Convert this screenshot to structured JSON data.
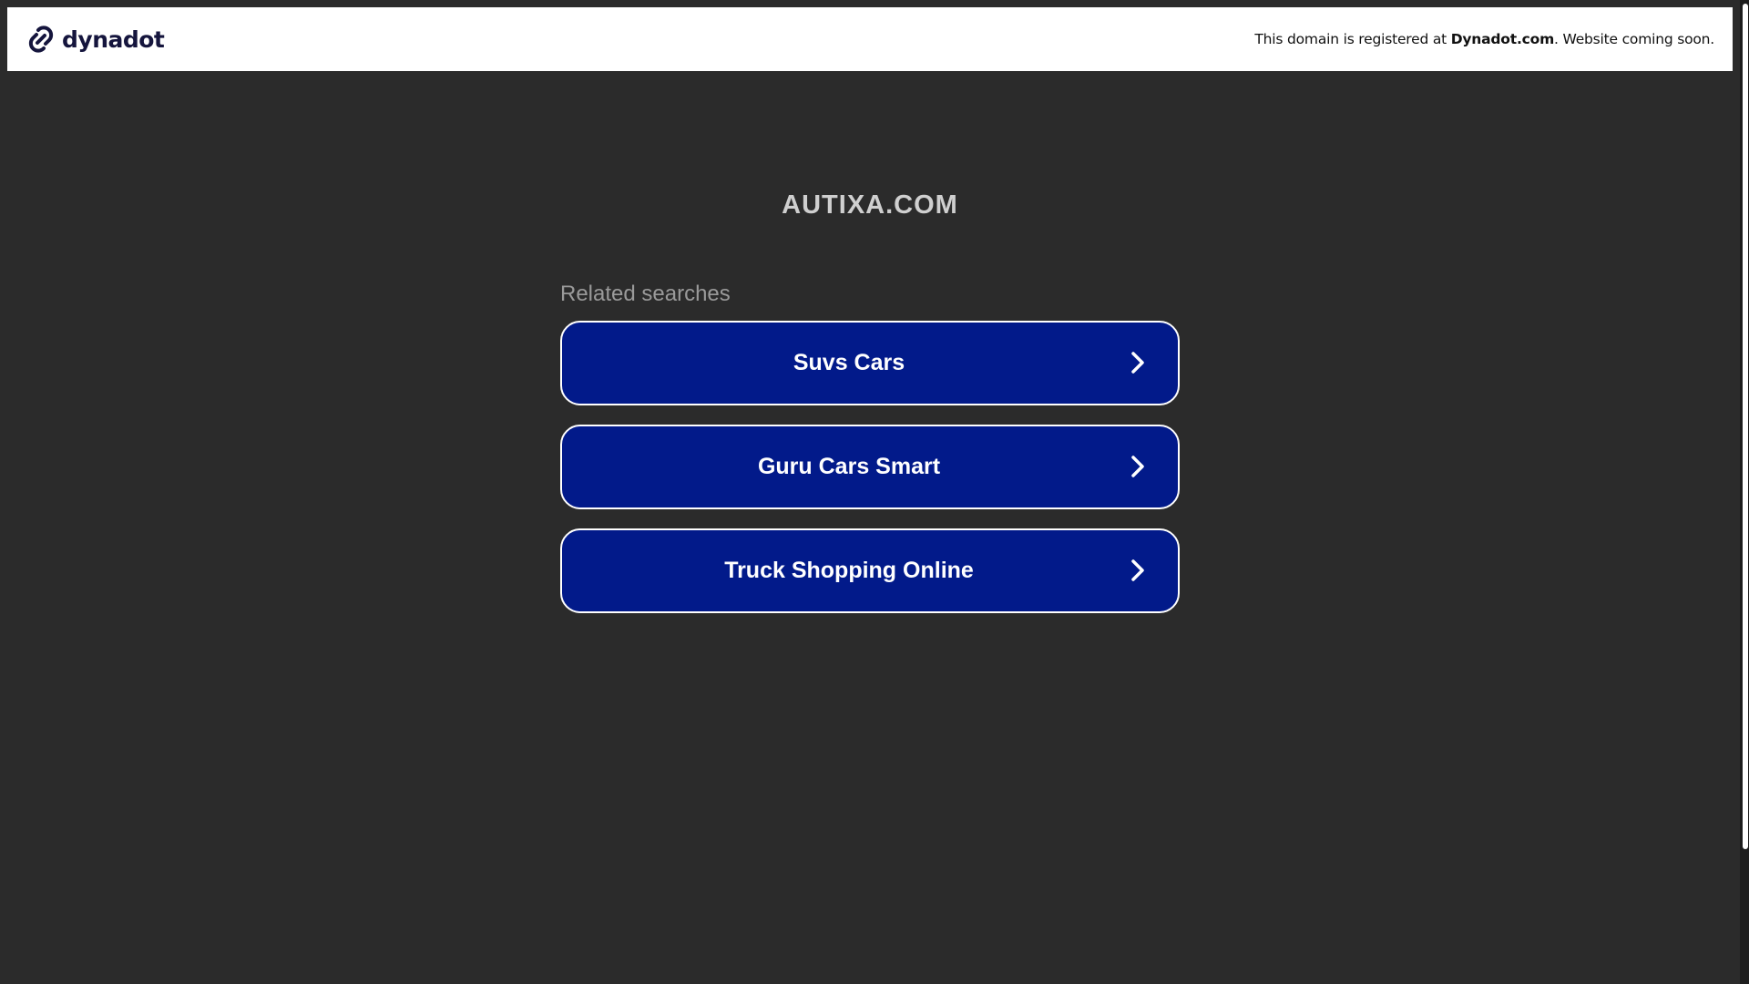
{
  "banner": {
    "logo_text": "dynadot",
    "notice_prefix": "This domain is registered at ",
    "notice_link": "Dynadot.com",
    "notice_suffix": ". Website coming soon."
  },
  "main": {
    "domain": "AUTIXA.COM",
    "related_label": "Related searches",
    "searches": [
      {
        "label": "Suvs Cars"
      },
      {
        "label": "Guru Cars Smart"
      },
      {
        "label": "Truck Shopping Online"
      }
    ]
  },
  "colors": {
    "background": "#2b2b2b",
    "banner": "#ffffff",
    "button": "#021a8a",
    "button_border": "#ffffff",
    "title": "#cfcfcf",
    "label": "#9a9a9a"
  },
  "icons": {
    "logo": "dynadot-link-icon",
    "chevron": "chevron-right-icon"
  }
}
